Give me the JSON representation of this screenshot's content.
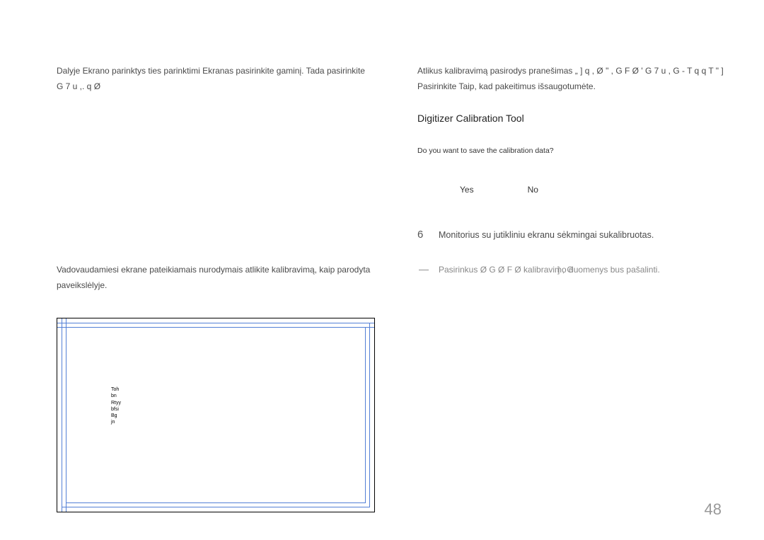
{
  "left": {
    "para1": "Dalyje Ekrano parinktys ties parinktimi Ekranas pasirinkite gaminį. Tada pasirinkite",
    "para1_sub": "G 7   u ,.   q Ø",
    "para2": "Vadovaudamiesi ekrane pateikiamais nurodymais atlikite kalibravimą, kaip parodyta paveikslėlyje.",
    "calib_text_lines": [
      "Toh",
      "bn",
      "Rtyy",
      "bfsi",
      "Bg",
      "jn"
    ]
  },
  "right": {
    "para1": "Atlikus kalibravimą pasirodys pranešimas    „ ] q ,  Ø \"     , G   F Ø     ' G 7   u , G -   T q      q T \" ]",
    "para1_sub": "Pasirinkite Taip, kad pakeitimus išsaugotumėte.",
    "dialog": {
      "title": "Digitizer Calibration Tool",
      "question": "Do you want to save the calibration data?",
      "yes": "Yes",
      "no": "No"
    },
    "step6": {
      "num": "6",
      "text": "Monitorius su jutikliniu ekranu sėkmingai sukalibruotas."
    },
    "note": {
      "dash": "―",
      "text": "Pasirinkus        Ø G Ø F Ø      kalibravimo duomenys bus pašalinti.",
      "text_overlay": "] , G"
    }
  },
  "page_number": "48"
}
